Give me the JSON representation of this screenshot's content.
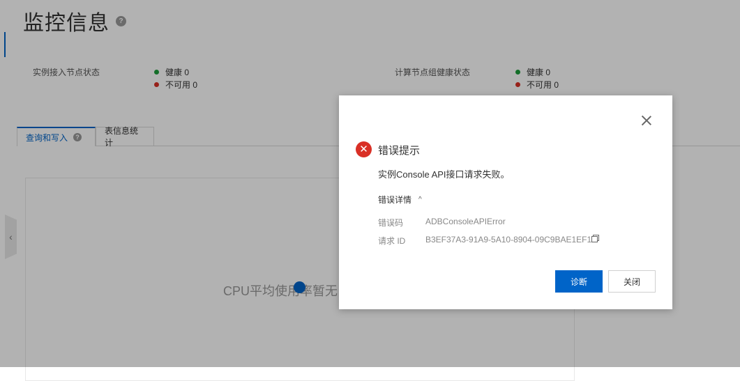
{
  "page": {
    "title": "监控信息",
    "help_glyph": "?"
  },
  "status": {
    "instance_nodes": {
      "label": "实例接入节点状态",
      "healthy": "健康 0",
      "unavailable": "不可用 0"
    },
    "compute_groups": {
      "label": "计算节点组健康状态",
      "healthy": "健康 0",
      "unavailable": "不可用 0"
    }
  },
  "tabs": [
    {
      "label": "查询和写入",
      "active": true
    },
    {
      "label": "表信息统计",
      "active": false
    }
  ],
  "chart": {
    "empty_text": "CPU平均使用率暂无"
  },
  "modal": {
    "title": "错误提示",
    "message": "实例Console API接口请求失败。",
    "details_label": "错误详情",
    "details_chevron": "^",
    "error_code_label": "错误码",
    "error_code": "ADBConsoleAPIError",
    "request_id_label": "请求 ID",
    "request_id": "B3EF37A3-91A9-5A10-8904-09C9BAE1EF10",
    "primary_button": "诊断",
    "secondary_button": "关闭",
    "error_glyph": "✕"
  },
  "colors": {
    "accent": "#0064c8",
    "healthy": "#1e9e3c",
    "error": "#d93026"
  }
}
